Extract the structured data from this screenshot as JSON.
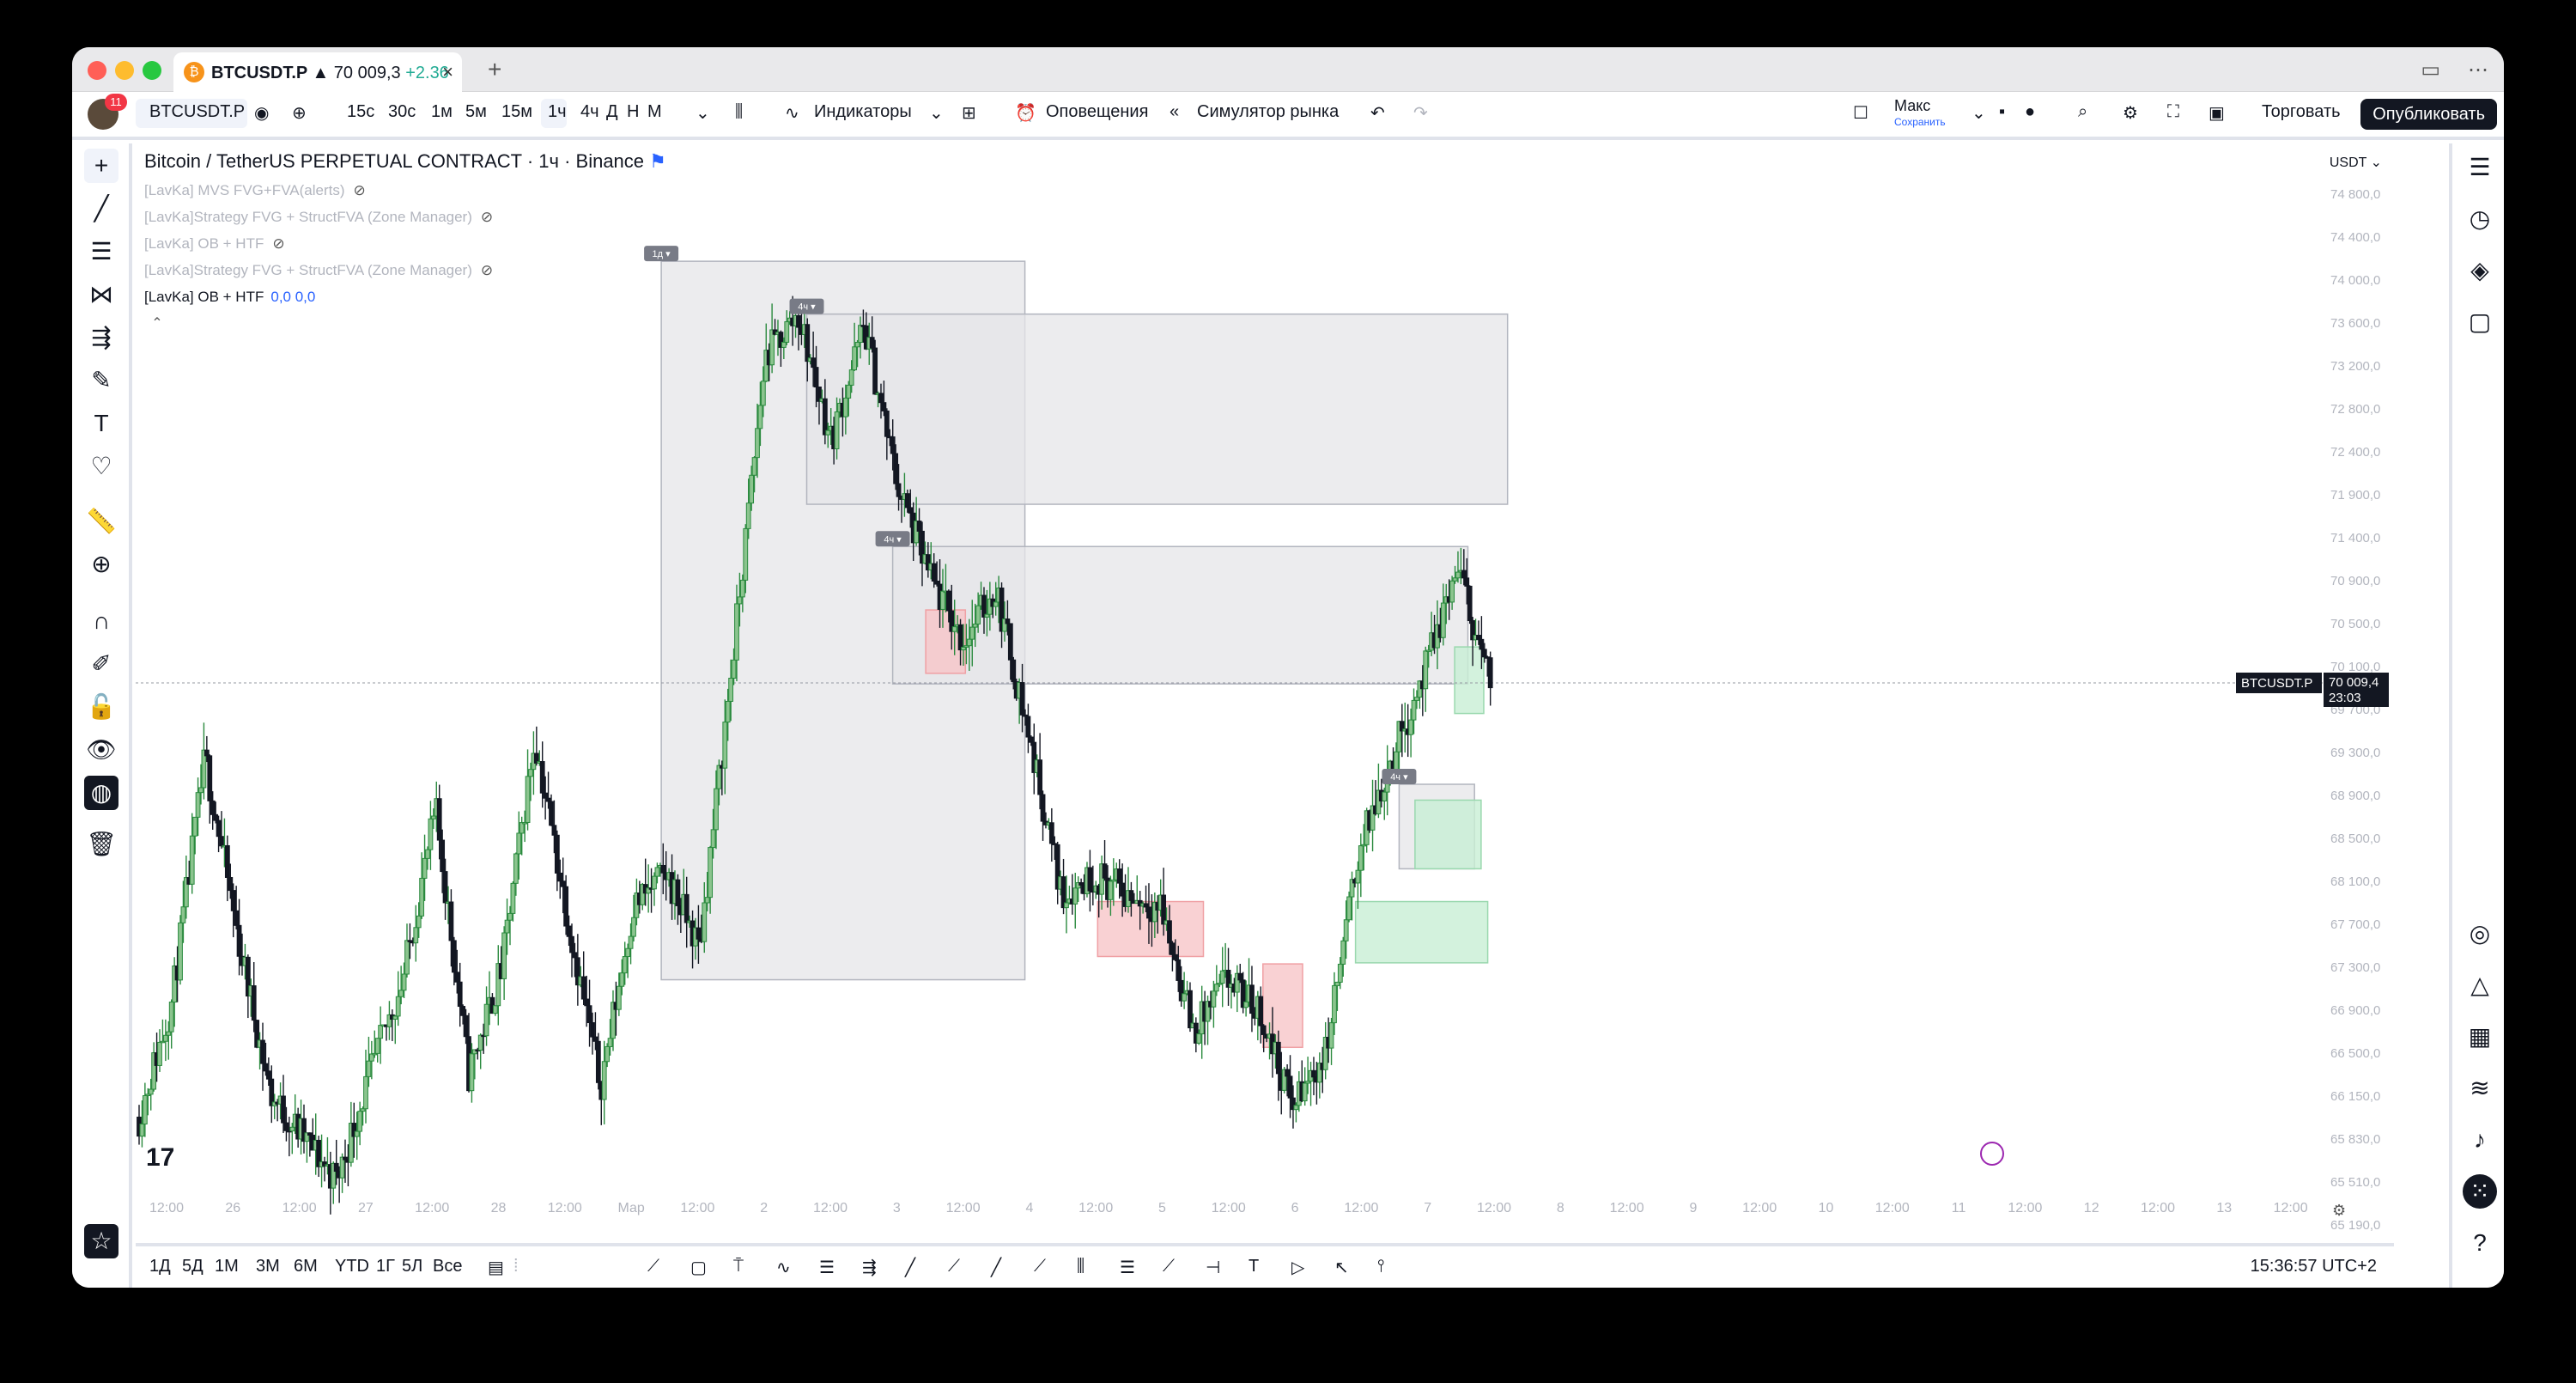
{
  "window": {
    "tab_title": "BTCUSDT.P",
    "tab_price": "▲ 70 009,3",
    "tab_change": "+2.36"
  },
  "toolbar": {
    "symbol": "BTCUSDT.P",
    "intervals": [
      "15с",
      "30с",
      "1м",
      "5м",
      "15м",
      "1ч",
      "4ч",
      "Д",
      "Н",
      "М"
    ],
    "active_interval": "1ч",
    "indicators_label": "Индикаторы",
    "alerts_label": "Оповещения",
    "replay_label": "Симулятор рынка",
    "layout_name": "Макс",
    "layout_save": "Сохранить",
    "trade_label": "Торговать",
    "publish_label": "Опубликовать"
  },
  "legend": {
    "title": "Bitcoin / TetherUS PERPETUAL CONTRACT · 1ч · Binance",
    "indicators": [
      {
        "name": "[LavKa] MVS FVG+FVA(alerts)",
        "active": false,
        "value": ""
      },
      {
        "name": "[LavKa]Strategy FVG + StructFVA (Zone Manager)",
        "active": false,
        "value": ""
      },
      {
        "name": "[LavKa] OB + HTF",
        "active": false,
        "value": ""
      },
      {
        "name": "[LavKa]Strategy FVG + StructFVA (Zone Manager)",
        "active": false,
        "value": ""
      },
      {
        "name": "[LavKa] OB + HTF",
        "active": true,
        "value": "0,0  0,0"
      }
    ]
  },
  "currency": "USDT",
  "price_scale": [
    "74 800,0",
    "74 400,0",
    "74 000,0",
    "73 600,0",
    "73 200,0",
    "72 800,0",
    "72 400,0",
    "71 900,0",
    "71 400,0",
    "70 900,0",
    "70 500,0",
    "70 100,0",
    "69 700,0",
    "69 300,0",
    "68 900,0",
    "68 500,0",
    "68 100,0",
    "67 700,0",
    "67 300,0",
    "66 900,0",
    "66 500,0",
    "66 150,0",
    "65 830,0",
    "65 510,0",
    "65 190,0"
  ],
  "current_price": {
    "symbol": "BTCUSDT.P",
    "price": "70 009,4",
    "countdown": "23:03",
    "value": 70009.4
  },
  "time_axis": [
    "12:00",
    "26",
    "12:00",
    "27",
    "12:00",
    "28",
    "12:00",
    "Мар",
    "12:00",
    "2",
    "12:00",
    "3",
    "12:00",
    "4",
    "12:00",
    "5",
    "12:00",
    "6",
    "12:00",
    "7",
    "12:00",
    "8",
    "12:00",
    "9",
    "12:00",
    "10",
    "12:00",
    "11",
    "12:00",
    "12",
    "12:00",
    "13",
    "12:00"
  ],
  "zone_labels": [
    "1д ▾",
    "4ч ▾",
    "4ч ▾",
    "4ч ▾"
  ],
  "ranges": [
    "1Д",
    "5Д",
    "1М",
    "3М",
    "6М",
    "YTD",
    "1Г",
    "5Л",
    "Все"
  ],
  "clock": "15:36:57 UTC+2",
  "colors": {
    "up": "#2a8a3e",
    "up_body": "#8bc48e",
    "down": "#131722",
    "accent": "#2962ff",
    "bull_zone": "#c8efd4",
    "bear_zone": "#f8c6c8",
    "htf_zone": "#e6e6e8"
  },
  "chart_data": {
    "type": "candlestick",
    "title": "Bitcoin / TetherUS PERPETUAL CONTRACT · 1ч · Binance",
    "ylim": [
      65050,
      75050
    ],
    "x_range": [
      "Feb 25 2024",
      "Mar 13 2024"
    ],
    "series": [
      {
        "name": "BTCUSDT.P",
        "approx_close_path": [
          65900,
          67000,
          69300,
          67600,
          66100,
          65700,
          65300,
          66300,
          67200,
          68800,
          66300,
          67300,
          69500,
          67800,
          66200,
          67900,
          68200,
          67500,
          70200,
          73100,
          73500,
          72300,
          73400,
          71900,
          71000,
          70400,
          70900,
          69500,
          68000,
          68200,
          68000,
          67900,
          66700,
          67200,
          66900,
          66000,
          66500,
          68400,
          69300,
          70100,
          71100,
          70000
        ]
      }
    ],
    "zones": [
      {
        "kind": "htf",
        "label": "1д ▾",
        "from": 4.35,
        "to": 7.1,
        "top": 74000,
        "bottom": 67200
      },
      {
        "kind": "htf",
        "label": "4ч ▾",
        "from": 5.45,
        "to": 10.75,
        "top": 73500,
        "bottom": 71700
      },
      {
        "kind": "htf",
        "label": "4ч ▾",
        "from": 6.1,
        "to": 10.45,
        "top": 71300,
        "bottom": 70000
      },
      {
        "kind": "htf",
        "label": "4ч ▾",
        "from": 9.93,
        "to": 10.5,
        "top": 69050,
        "bottom": 68250
      },
      {
        "kind": "bear",
        "from": 6.35,
        "to": 6.65,
        "top": 70700,
        "bottom": 70100
      },
      {
        "kind": "bear",
        "from": 7.65,
        "to": 8.45,
        "top": 67940,
        "bottom": 67420
      },
      {
        "kind": "bear",
        "from": 8.9,
        "to": 9.2,
        "top": 67350,
        "bottom": 66560
      },
      {
        "kind": "bull",
        "from": 9.6,
        "to": 10.6,
        "top": 67940,
        "bottom": 67360
      },
      {
        "kind": "bull",
        "from": 10.05,
        "to": 10.55,
        "top": 68900,
        "bottom": 68250
      },
      {
        "kind": "bull",
        "from": 10.35,
        "to": 10.57,
        "top": 70350,
        "bottom": 69720
      }
    ]
  }
}
